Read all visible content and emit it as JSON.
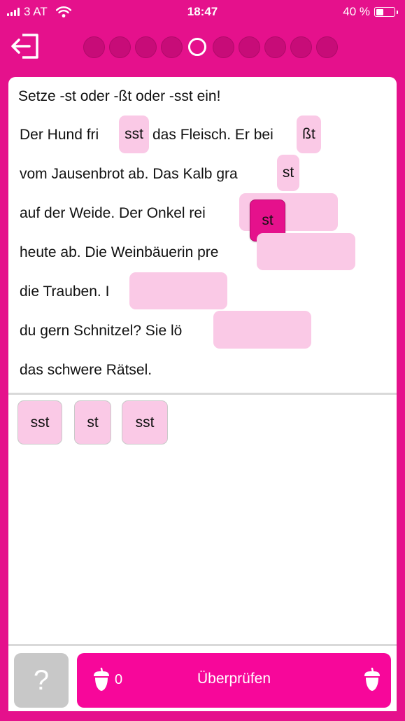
{
  "status": {
    "carrier": "3 AT",
    "time": "18:47",
    "battery_text": "40 %",
    "battery_fraction": 0.4,
    "wifi_icon": "wifi-icon",
    "signal_icon": "signal-bars-icon"
  },
  "topbar": {
    "back_icon": "exit-arrow-icon",
    "progress_total": 10,
    "progress_current_index": 4
  },
  "exercise": {
    "instruction": "Setze -st oder -ßt oder -sst ein!",
    "lines": [
      "Der Hund fri",
      "das Fleisch. Er bei",
      "vom Jausenbrot ab. Das Kalb gra",
      "auf der Weide. Der Onkel rei",
      "heute ab. Die Weinbäuerin pre",
      "die Trauben. I",
      "du gern Schnitzel? Sie lö",
      "das schwere Rätsel."
    ],
    "gaps": [
      "sst",
      "ßt",
      "st",
      "",
      "",
      "",
      ""
    ],
    "dragging_tile": "st"
  },
  "bank": {
    "items": [
      "sst",
      "st",
      "sst"
    ]
  },
  "footer": {
    "help_label": "?",
    "check_label": "Überprüfen",
    "score": "0",
    "acorn_icon": "acorn-icon"
  },
  "colors": {
    "brand": "#e5118c",
    "button": "#f7079a",
    "gap_fill": "#fac9e6",
    "help_bg": "#c8c8c8"
  }
}
